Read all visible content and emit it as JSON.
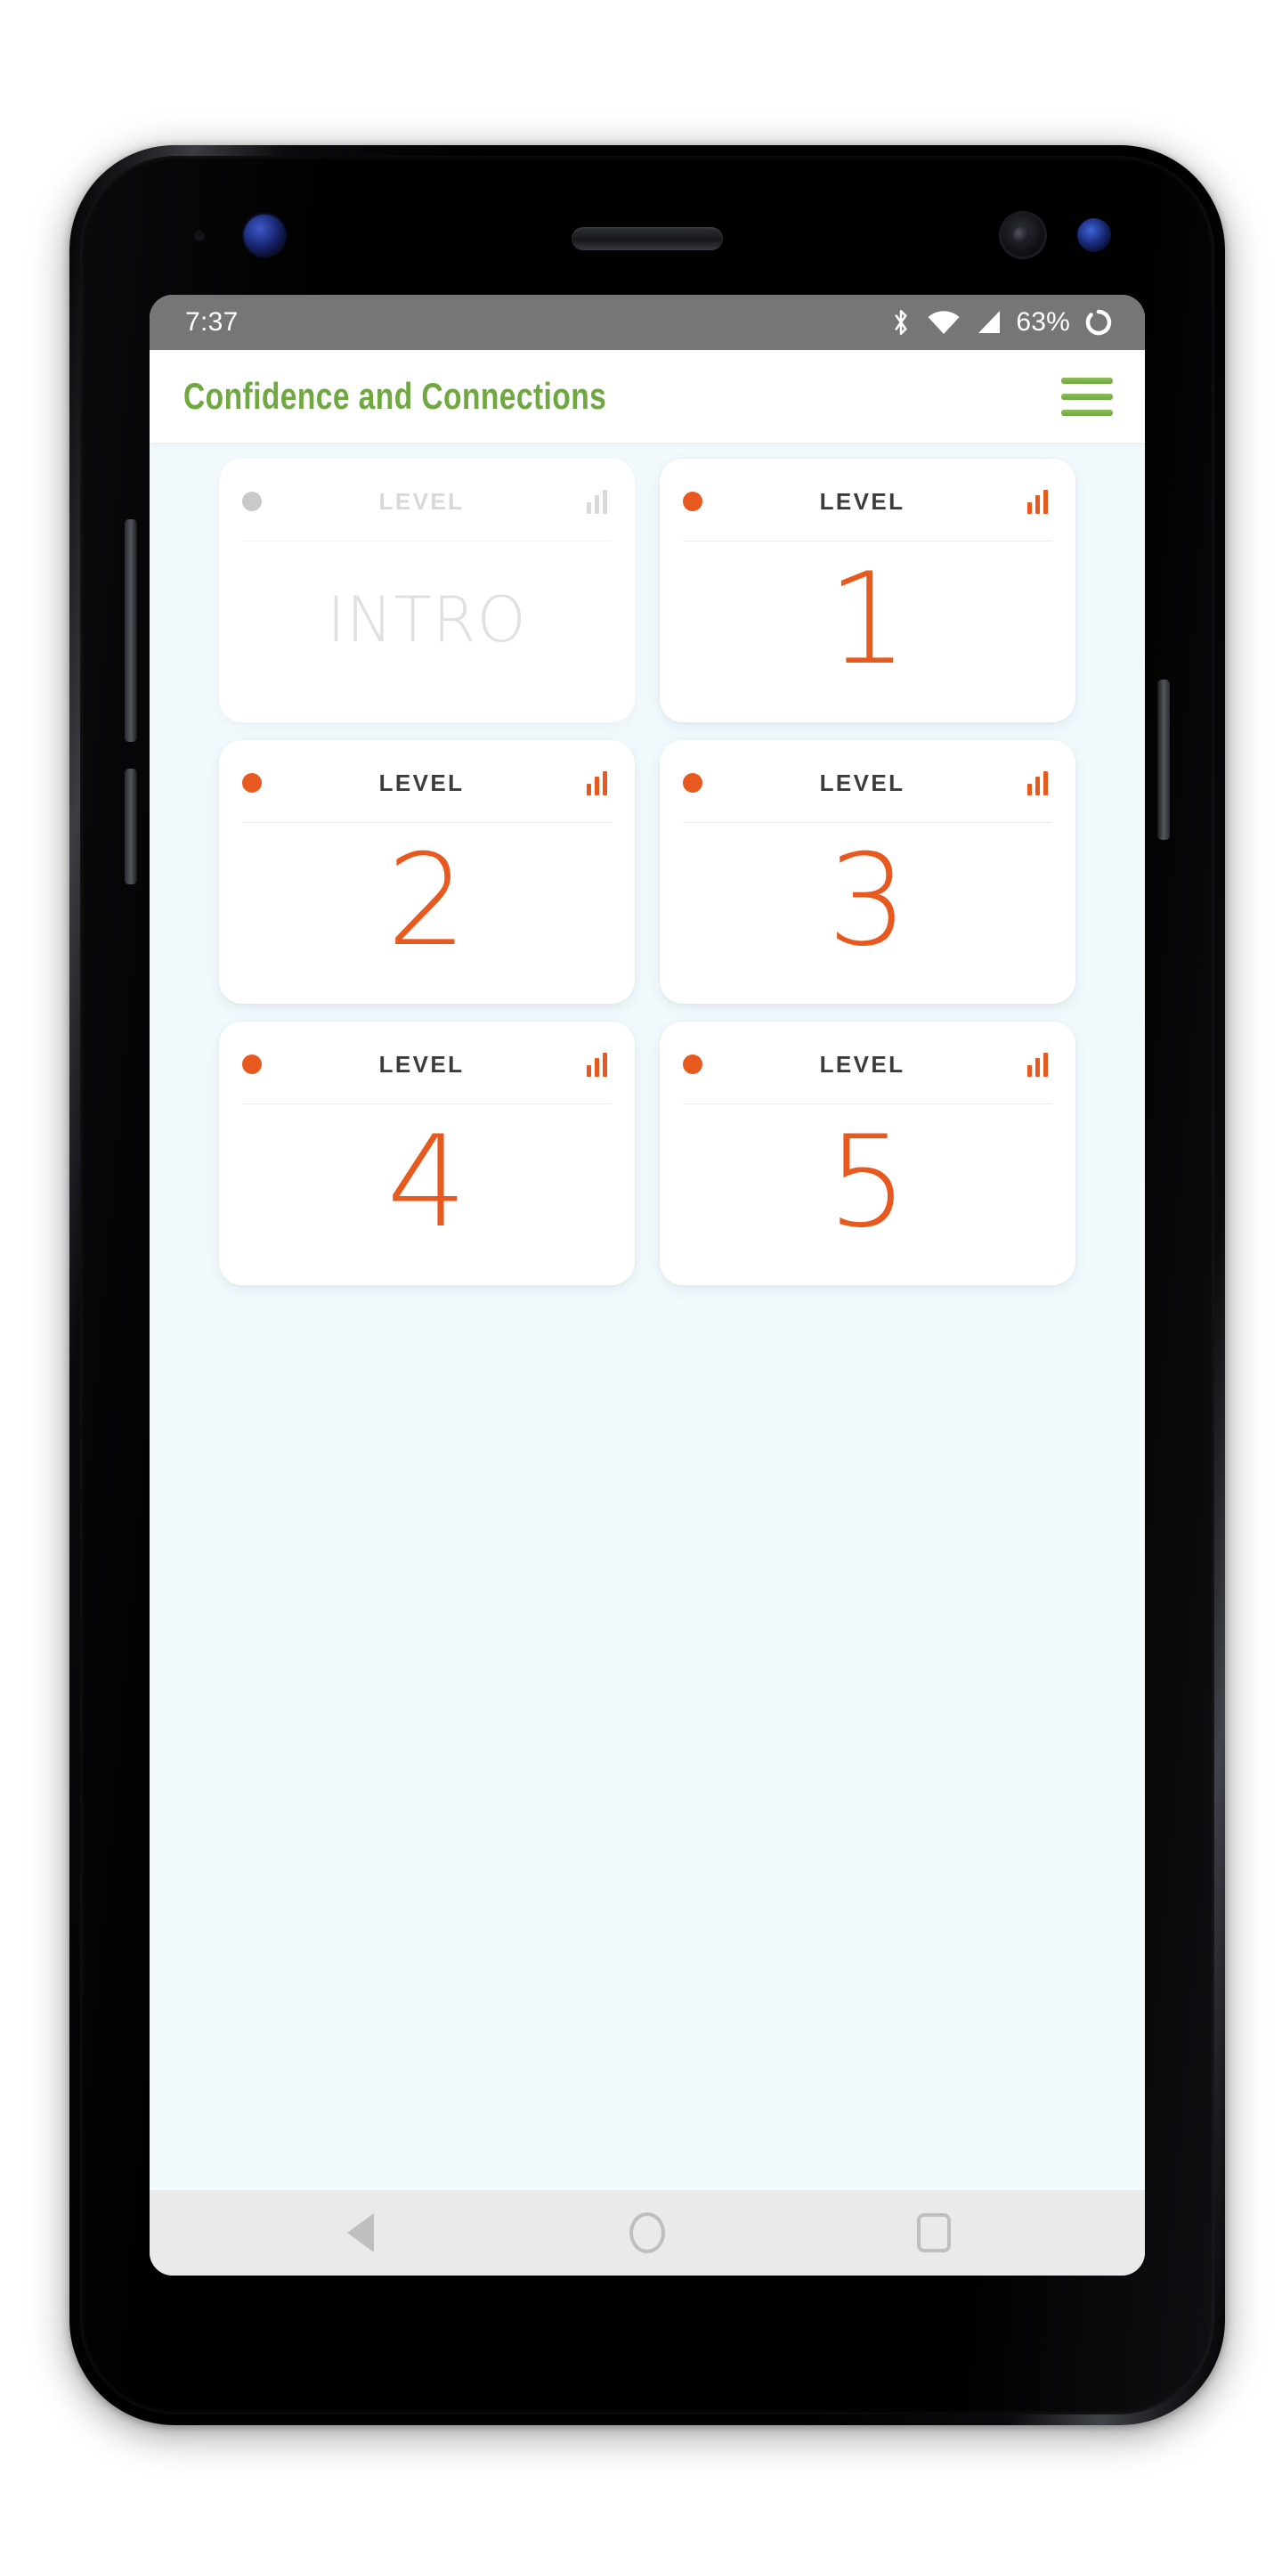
{
  "status_bar": {
    "clock": "7:37",
    "battery_percent": "63%",
    "icons": [
      "bluetooth-icon",
      "wifi-icon",
      "cellular-signal-icon",
      "battery-circle-icon"
    ]
  },
  "app_bar": {
    "title": "Confidence and Connections",
    "title_color": "#6FA840",
    "menu_icon": "hamburger-menu-icon"
  },
  "theme": {
    "accent": "#E8591F",
    "brand_green": "#6FA840",
    "page_background": "#F2FAFD",
    "card_background": "#FFFFFF",
    "disabled_gray": "#D8D8D8"
  },
  "levels": [
    {
      "label": "LEVEL",
      "value": "INTRO",
      "state": "disabled",
      "dot_color": "#C9C9C9",
      "value_color": "#E0E0E0",
      "bars_icon": "bar-chart-icon"
    },
    {
      "label": "LEVEL",
      "value": "1",
      "state": "active",
      "dot_color": "#E8591F",
      "value_color": "#E8591F",
      "bars_icon": "bar-chart-icon"
    },
    {
      "label": "LEVEL",
      "value": "2",
      "state": "active",
      "dot_color": "#E8591F",
      "value_color": "#E8591F",
      "bars_icon": "bar-chart-icon"
    },
    {
      "label": "LEVEL",
      "value": "3",
      "state": "active",
      "dot_color": "#E8591F",
      "value_color": "#E8591F",
      "bars_icon": "bar-chart-icon"
    },
    {
      "label": "LEVEL",
      "value": "4",
      "state": "active",
      "dot_color": "#E8591F",
      "value_color": "#E8591F",
      "bars_icon": "bar-chart-icon"
    },
    {
      "label": "LEVEL",
      "value": "5",
      "state": "active",
      "dot_color": "#E8591F",
      "value_color": "#E8591F",
      "bars_icon": "bar-chart-icon"
    }
  ],
  "nav_bar": {
    "back": "back-triangle-icon",
    "home": "home-circle-icon",
    "recents": "recents-square-icon"
  }
}
